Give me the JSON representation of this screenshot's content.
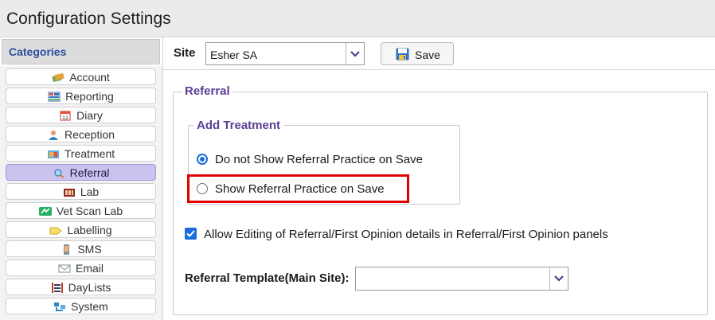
{
  "window": {
    "title": "Configuration Settings"
  },
  "sidebar": {
    "header": "Categories",
    "selected": "Referral",
    "items": [
      {
        "label": "Account",
        "icon": "account-icon"
      },
      {
        "label": "Reporting",
        "icon": "reporting-icon"
      },
      {
        "label": "Diary",
        "icon": "calendar-icon"
      },
      {
        "label": "Reception",
        "icon": "person-icon"
      },
      {
        "label": "Treatment",
        "icon": "treatment-icon"
      },
      {
        "label": "Referral",
        "icon": "referral-icon"
      },
      {
        "label": "Lab",
        "icon": "lab-icon"
      },
      {
        "label": "Vet Scan Lab",
        "icon": "vet-scan-icon"
      },
      {
        "label": "Labelling",
        "icon": "label-icon"
      },
      {
        "label": "SMS",
        "icon": "phone-icon"
      },
      {
        "label": "Email",
        "icon": "envelope-icon"
      },
      {
        "label": "DayLists",
        "icon": "list-icon"
      },
      {
        "label": "System",
        "icon": "system-icon"
      }
    ]
  },
  "toolbar": {
    "site_label": "Site",
    "site_value": "Esher SA",
    "save_label": "Save",
    "save_icon": "floppy-disk-icon"
  },
  "referral": {
    "title": "Referral",
    "add_treatment": {
      "title": "Add Treatment",
      "options": [
        {
          "label": "Do not Show Referral Practice on Save",
          "checked": true
        },
        {
          "label": "Show Referral Practice on Save",
          "checked": false
        }
      ]
    },
    "allow_editing": {
      "label": "Allow Editing of Referral/First Opinion details in Referral/First Opinion panels",
      "checked": true
    },
    "template": {
      "label": "Referral Template(Main Site):",
      "value": ""
    }
  },
  "colors": {
    "accent": "#1a6dd9",
    "legend": "#5b3d96",
    "highlight": "#e00000",
    "selected_item": "#c9c3ee",
    "category_header": "#2d4f9e"
  }
}
